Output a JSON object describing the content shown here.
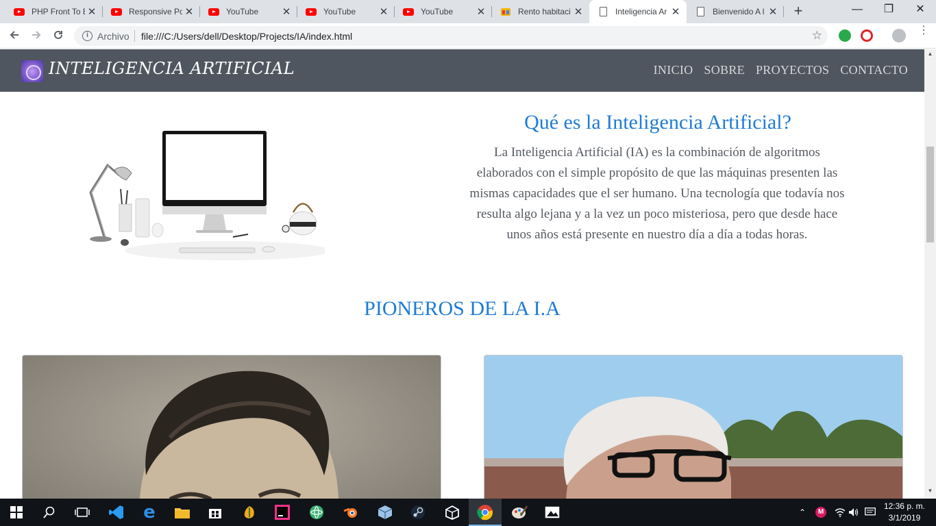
{
  "browser": {
    "tabs": [
      {
        "title": "PHP Front To B",
        "icon": "youtube-icon"
      },
      {
        "title": "Responsive Po",
        "icon": "youtube-icon"
      },
      {
        "title": "YouTube",
        "icon": "youtube-icon"
      },
      {
        "title": "YouTube",
        "icon": "youtube-icon"
      },
      {
        "title": "YouTube",
        "icon": "youtube-icon"
      },
      {
        "title": "Rento habitaci",
        "icon": "site-icon"
      },
      {
        "title": "Inteligencia Ar",
        "icon": "document-icon",
        "active": true
      },
      {
        "title": "Bienvenido A l",
        "icon": "document-icon"
      }
    ],
    "new_tab_glyph": "+",
    "address": {
      "scheme_label": "Archivo",
      "url": "file:///C:/Users/dell/Desktop/Projects/IA/index.html"
    }
  },
  "site": {
    "brand": "INTELIGENCIA ARTIFICIAL",
    "nav": [
      "INICIO",
      "SOBRE",
      "PROYECTOS",
      "CONTACTO"
    ],
    "hero": {
      "title": "Qué es la Inteligencia Artificial?",
      "text": "La Inteligencia Artificial (IA) es la combinación de algoritmos elaborados con el simple propósito de que las máquinas presenten las mismas capacidades que el ser humano. Una tecnología que todavía nos resulta algo lejana y a la vez un poco misteriosa, pero que desde hace unos años está presente en nuestro día a día a todas horas."
    },
    "pioneers_title": "PIONEROS DE LA I.A"
  },
  "taskbar": {
    "apps": [
      "windows-start-icon",
      "search-icon",
      "task-view-icon",
      "vscode-icon",
      "edge-icon",
      "file-explorer-icon",
      "store-icon",
      "fl-studio-icon",
      "intellij-icon",
      "atom-icon",
      "blender-icon",
      "virtualbox-icon",
      "steam-icon",
      "unity-icon",
      "chrome-icon",
      "paint-icon",
      "photos-icon"
    ],
    "clock": {
      "time": "12:36 p. m.",
      "date": "3/1/2019"
    }
  },
  "colors": {
    "accent": "#1e7cd6",
    "navbar": "#4f565f",
    "body_text": "#555a60"
  }
}
